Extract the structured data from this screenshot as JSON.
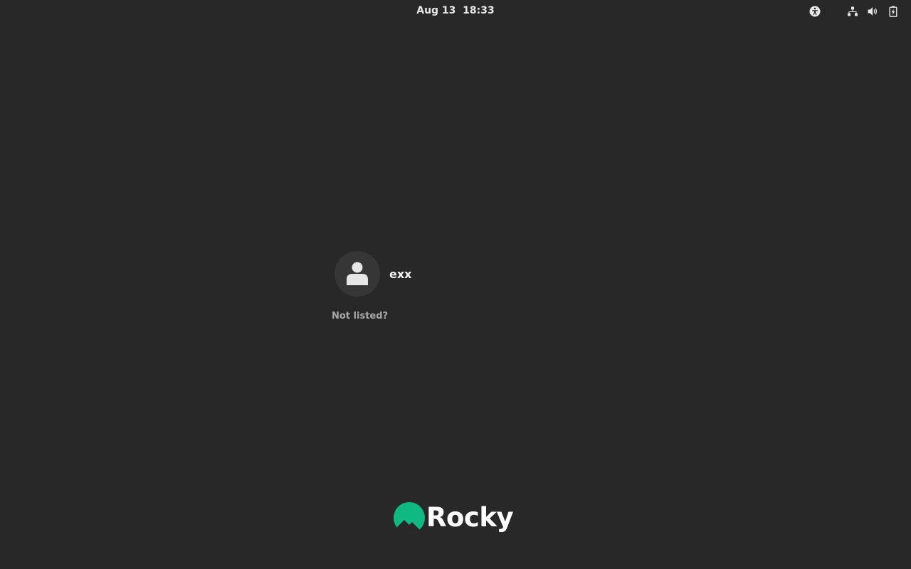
{
  "topbar": {
    "date": "Aug 13",
    "time": "18:33",
    "icons": [
      "accessibility-icon",
      "network-icon",
      "volume-icon",
      "battery-icon"
    ]
  },
  "users": [
    {
      "name": "exx",
      "avatar": "person-icon"
    }
  ],
  "not_listed_label": "Not listed?",
  "branding": {
    "logo_text": "Rocky",
    "logo_color": "#10b981"
  },
  "colors": {
    "background": "#282828",
    "avatar_bg": "#363636"
  }
}
